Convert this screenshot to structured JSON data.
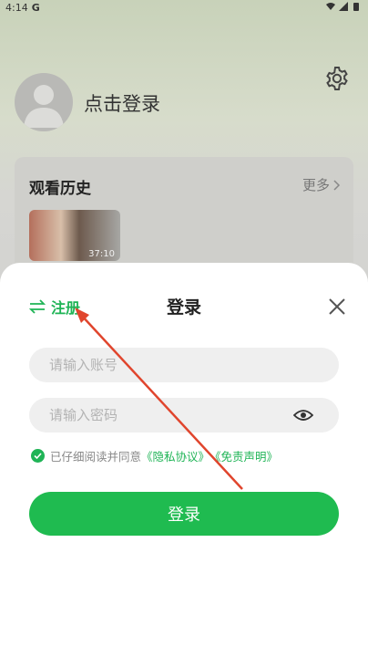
{
  "statusbar": {
    "time": "4:14",
    "g": "G"
  },
  "profile": {
    "login_prompt": "点击登录"
  },
  "history": {
    "title": "观看历史",
    "more": "更多",
    "duration": "37:10"
  },
  "sheet": {
    "switch_register": "注册",
    "title": "登录",
    "account_placeholder": "请输入账号",
    "password_placeholder": "请输入密码",
    "agree_prefix": "已仔细阅读并同意",
    "privacy_link": "《隐私协议》",
    "disclaimer_link": "《免责声明》",
    "login_button": "登录"
  },
  "colors": {
    "accent": "#1fb456",
    "annotation": "#e0452d"
  }
}
